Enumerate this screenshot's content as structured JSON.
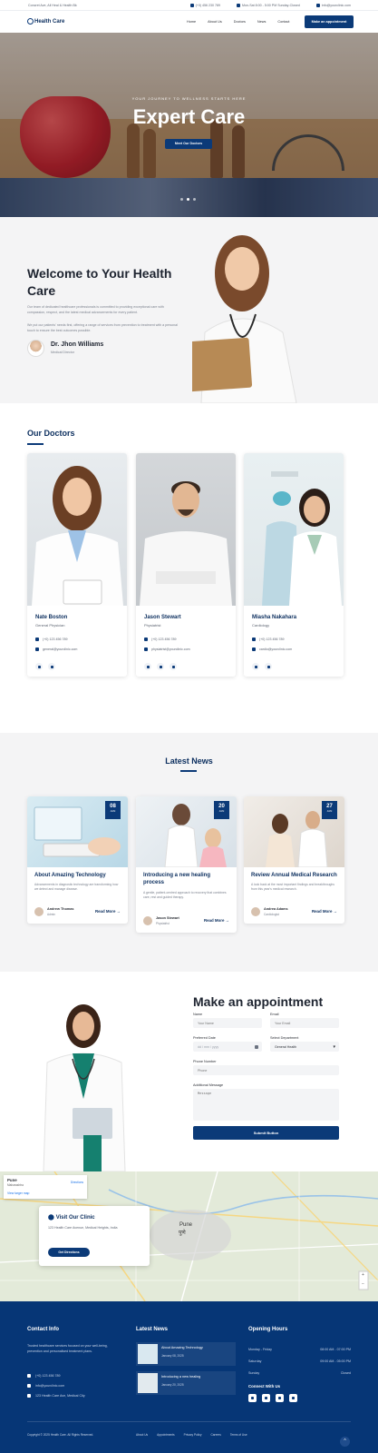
{
  "topbar": {
    "address": "Concret Ave, All Heal & Health Bk",
    "phone": "(+0) 456 230 789",
    "hours": "Mon-Sat 8:00 - 5:00 PM Sunday-Closed",
    "email": "info@yourclinic.com"
  },
  "nav": {
    "logo": "Health Care",
    "items": [
      "Home",
      "About Us",
      "Doctors",
      "News",
      "Contact"
    ],
    "cta": "Make an appointment"
  },
  "hero": {
    "kicker": "YOUR JOURNEY TO WELLNESS STARTS HERE",
    "title": "Expert Care",
    "button": "Meet Our Doctors"
  },
  "welcome": {
    "title": "Welcome to Your Health Care",
    "para1": "Our team of dedicated healthcare professionals is committed to providing exceptional care with compassion, respect, and the latest medical advancements for every patient.",
    "para2": "We put our patients' needs first, offering a range of services from prevention to treatment with a personal touch to ensure the best outcomes possible.",
    "doctor_name": "Dr. Jhon Williams",
    "doctor_role": "Medical Director"
  },
  "doctors": {
    "title": "Our Doctors",
    "items": [
      {
        "name": "Nate Boston",
        "role": "General Physician",
        "phone": "(+0) 123 456 789",
        "email": "general@yourclinic.com"
      },
      {
        "name": "Jason Stewart",
        "role": "Physiatrist",
        "phone": "(+0) 123 456 789",
        "email": "physiatrist@yourclinic.com"
      },
      {
        "name": "Miasha Nakahara",
        "role": "Cardiology",
        "phone": "(+0) 123 456 789",
        "email": "cardio@yourclinic.com"
      }
    ]
  },
  "news": {
    "title": "Latest News",
    "items": [
      {
        "day": "08",
        "month": "JAN",
        "title": "About Amazing Technology",
        "excerpt": "Advancements in diagnostic technology are transforming how we detect and manage disease.",
        "author": "Andrew Thomas",
        "author_role": "Admin",
        "read_more": "Read More →"
      },
      {
        "day": "20",
        "month": "JAN",
        "title": "Introducing a new healing process",
        "excerpt": "A gentle, patient-centred approach to recovery that combines care, rest and guided therapy.",
        "author": "Jason Stewart",
        "author_role": "Physiatrist",
        "read_more": "Read More →"
      },
      {
        "day": "27",
        "month": "JAN",
        "title": "Review Annual Medical Research",
        "excerpt": "A look back at the most important findings and breakthroughs from this year's medical research.",
        "author": "Andrea Adams",
        "author_role": "Cardiologist",
        "read_more": "Read More →"
      }
    ]
  },
  "appointment": {
    "title": "Make an appointment",
    "name_label": "Name",
    "name_placeholder": "Your Name",
    "email_label": "Email",
    "email_placeholder": "Your Email",
    "date_label": "Preferred Date",
    "date_placeholder": "dd / mm / yyyy",
    "dept_label": "Select Department",
    "dept_value": "General Health",
    "phone_label": "Phone Number",
    "phone_placeholder": "Phone",
    "message_label": "Additional Message",
    "message_placeholder": "Message",
    "submit": "Submit Button"
  },
  "map": {
    "place": "Pune",
    "place_sub": "Maharashtra",
    "directions": "Directions",
    "view_larger": "View larger map",
    "city_label": "Pune",
    "city_label_local": "पुणे",
    "clinic_title": "Visit Our Clinic",
    "clinic_address": "123 Health Care Avenue, Medical Heights, India",
    "clinic_button": "Get Directions"
  },
  "footer": {
    "contact_title": "Contact Info",
    "contact_text": "Trusted healthcare services focused on your well-being, prevention and personalised treatment plans.",
    "phone": "(+0) 123 456 789",
    "email": "info@yourclinic.com",
    "address": "123 Health Care Ave, Medical City",
    "news_title": "Latest News",
    "news_items": [
      {
        "title": "About Amazing Technology",
        "date": "January 08, 2025"
      },
      {
        "title": "Introducing a new healing",
        "date": "January 20, 2025"
      }
    ],
    "hours_title": "Opening Hours",
    "hours": [
      {
        "day": "Monday - Friday",
        "time": "08:00 AM - 07:00 PM"
      },
      {
        "day": "Saturday",
        "time": "09:00 AM - 05:00 PM"
      },
      {
        "day": "Sunday",
        "time": "Closed"
      }
    ],
    "connect_title": "Connect With Us",
    "copyright": "Copyright © 2025 Health Care. All Rights Reserved.",
    "links": [
      "About Us",
      "Appointments",
      "Privacy Policy",
      "Careers",
      "Terms of Use"
    ]
  },
  "colors": {
    "primary": "#0b3a78",
    "footer": "#063676",
    "section_bg": "#f4f4f5"
  }
}
